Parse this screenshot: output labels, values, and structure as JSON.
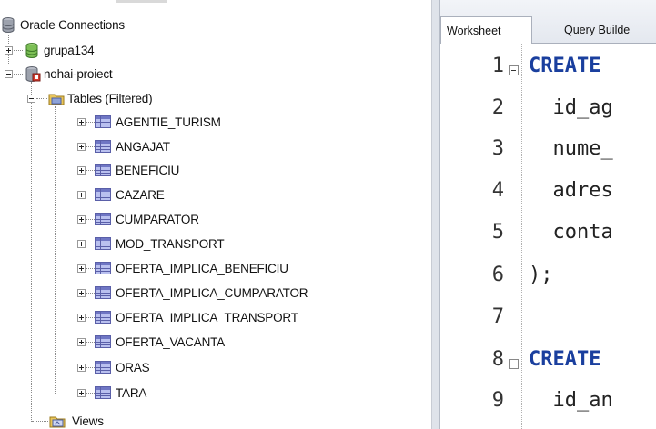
{
  "tree": {
    "root": {
      "label": "Oracle Connections"
    },
    "connections": [
      {
        "label": "grupa134",
        "expanded": false
      },
      {
        "label": "nohai-proiect",
        "expanded": true
      }
    ],
    "tables_folder": {
      "label": "Tables (Filtered)"
    },
    "tables": [
      "AGENTIE_TURISM",
      "ANGAJAT",
      "BENEFICIU",
      "CAZARE",
      "CUMPARATOR",
      "MOD_TRANSPORT",
      "OFERTA_IMPLICA_BENEFICIU",
      "OFERTA_IMPLICA_CUMPARATOR",
      "OFERTA_IMPLICA_TRANSPORT",
      "OFERTA_VACANTA",
      "ORAS",
      "TARA"
    ],
    "views_folder": {
      "label": "Views"
    }
  },
  "editor": {
    "tabs": [
      {
        "label": "Worksheet",
        "active": true
      },
      {
        "label": "Query Builde",
        "active": false
      }
    ],
    "lines": [
      {
        "number": "1",
        "text": "CREATE",
        "keyword": true,
        "fold": true
      },
      {
        "number": "2",
        "text": "  id_ag",
        "keyword": false,
        "fold": false
      },
      {
        "number": "3",
        "text": "  nume_",
        "keyword": false,
        "fold": false
      },
      {
        "number": "4",
        "text": "  adres",
        "keyword": false,
        "fold": false
      },
      {
        "number": "5",
        "text": "  conta",
        "keyword": false,
        "fold": false
      },
      {
        "number": "6",
        "text": ");",
        "keyword": false,
        "fold": false
      },
      {
        "number": "7",
        "text": "",
        "keyword": false,
        "fold": false
      },
      {
        "number": "8",
        "text": "CREATE",
        "keyword": true,
        "fold": true
      },
      {
        "number": "9",
        "text": "  id_an",
        "keyword": false,
        "fold": false
      }
    ]
  },
  "colors": {
    "keyword": "#1a3f9e",
    "table_icon_fill": "#b9c0ef",
    "splitter": "#dfe3ea"
  }
}
